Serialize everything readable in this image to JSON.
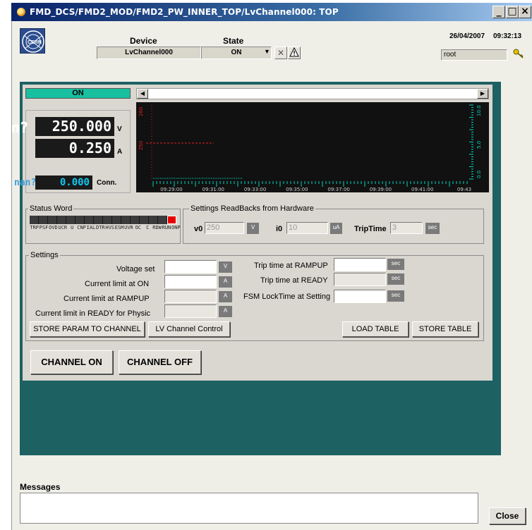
{
  "window": {
    "title": "FMD_DCS/FMD2_MOD/FMD2_PW_INNER_TOP/LvChannel000: TOP",
    "min_label": "_",
    "max_label": "□",
    "close_label": "×"
  },
  "header": {
    "device_header": "Device",
    "state_header": "State",
    "device_value": "LvChannel000",
    "state_value": "ON",
    "date": "26/04/2007",
    "time": "09:32:13",
    "user": "root",
    "logo": "CERN"
  },
  "status": {
    "state": "ON"
  },
  "readouts": {
    "voltage_prefix": "n?",
    "voltage": "250.000",
    "voltage_unit": "V",
    "current": "0.250",
    "current_unit": "A",
    "conn_prefix": "nan?",
    "conn_value": "0.000",
    "conn_label": "Conn."
  },
  "plot": {
    "left_ticks": [
      "260",
      "250"
    ],
    "right_ticks": [
      "10.0",
      "5.0",
      "0.0"
    ],
    "time_labels": [
      "09:29:00",
      "09:31:00",
      "09:33:00",
      "09:35:00",
      "09:37:00",
      "09:39:00",
      "09:41:00",
      "09:43"
    ]
  },
  "status_word": {
    "title": "Status Word",
    "bit_count": 16,
    "active_bit_index": 15,
    "labels": [
      "TRP",
      "PSF",
      "OVD",
      "UCR",
      "U",
      "CNP",
      "IAL",
      "DTR",
      "HVS",
      "ESM",
      "UVR",
      "OC",
      "C",
      "RDW",
      "RUN",
      "ONP"
    ]
  },
  "readbacks": {
    "title": "Settings ReadBacks from Hardware",
    "v0_label": "v0",
    "v0_value": "250",
    "v0_unit": "V",
    "i0_label": "i0",
    "i0_value": "10",
    "i0_unit": "uA",
    "trip_label": "TripTime",
    "trip_value": "3",
    "trip_unit": "sec"
  },
  "settings": {
    "title": "Settings",
    "voltage_set": "Voltage set",
    "current_on": "Current limit at ON",
    "current_rampup": "Current limit at RAMPUP",
    "current_ready": "Current limit in READY for Physic",
    "trip_rampup": "Trip time at RAMPUP",
    "trip_ready": "Trip time at READY",
    "fsm_lock": "FSM LockTime at Setting",
    "unit_v": "V",
    "unit_a": "A",
    "unit_sec": "sec"
  },
  "buttons": {
    "store_param": "STORE PARAM TO CHANNEL",
    "lv_control": "LV Channel Control",
    "load_table": "LOAD TABLE",
    "store_table": "STORE TABLE",
    "channel_on": "CHANNEL ON",
    "channel_off": "CHANNEL OFF",
    "close": "Close"
  },
  "messages": {
    "label": "Messages"
  },
  "colors": {
    "teal_panel": "#1d6163",
    "status_on": "#18c0a0",
    "plot_bg": "#111111",
    "voltage_trace": "#e02020",
    "current_trace": "#00d4c0",
    "active_bit": "#e80000"
  }
}
